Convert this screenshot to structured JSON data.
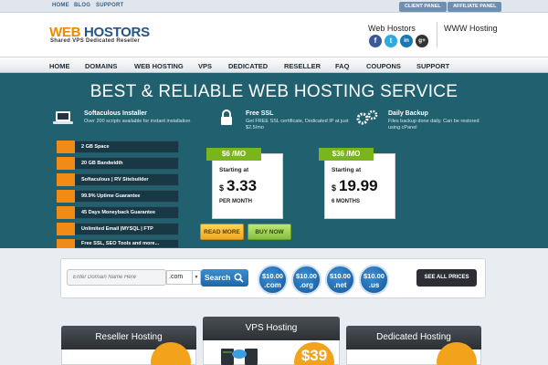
{
  "topbar": {
    "links": [
      "HOME",
      "BLOG",
      "SUPPORT"
    ],
    "client_panel": "CLIENT PANEL",
    "affiliate_panel": "AFFILIATE PANEL"
  },
  "header": {
    "logo_part1": "WEB ",
    "logo_part2": "HOSTORS",
    "tagline": "Shared   VPS   Dedicated   Reseller",
    "brand_name": "Web Hostors",
    "www_hosting": "WWW Hosting",
    "social": [
      "f",
      "t",
      "in",
      "g+"
    ]
  },
  "nav": [
    "HOME",
    "DOMAINS",
    "WEB HOSTING",
    "VPS",
    "DEDICATED",
    "RESELLER",
    "FAQ",
    "COUPONS",
    "SUPPORT"
  ],
  "banner": {
    "title": "BEST & RELIABLE WEB HOSTING SERVICE",
    "features": [
      {
        "title": "Softaculous Installer",
        "desc": "Over 200 scripts available for instant installation"
      },
      {
        "title": "Free SSL",
        "desc": "Get FREE SSL certificate, Dedicated IP at just $2.5/mo"
      },
      {
        "title": "Daily Backup",
        "desc": "Files backup done daily. Can be restored using cPanel"
      }
    ],
    "checklist": [
      "2 GB Space",
      "20 GB Bandwidth",
      "Softaculous | RV Sitebuilder",
      "99.9% Uptime Guarantee",
      "45 Days Moneyback Guarantee",
      "Unlimited Email |MYSQL | FTP",
      "Free SSL, SEO Tools and more..."
    ],
    "plans": [
      {
        "ribbon": "$6 /MO",
        "starting": "Starting at",
        "dollar": "$",
        "amount": "3.33",
        "period": "PER MONTH"
      },
      {
        "ribbon": "$36 /MO",
        "starting": "Starting at",
        "dollar": "$",
        "amount": "19.99",
        "period": "6 MONTHS"
      }
    ],
    "read_more": "READ MORE",
    "buy_now": "BUY NOW"
  },
  "domain_search": {
    "placeholder": "Enter Domain Name Here",
    "tld_selected": ".com",
    "search_label": "Search",
    "tlds": [
      {
        "price": "$10.00",
        "ext": ".com"
      },
      {
        "price": "$10.00",
        "ext": ".org"
      },
      {
        "price": "$10.00",
        "ext": ".net"
      },
      {
        "price": "$10.00",
        "ext": ".us"
      }
    ],
    "see_all": "SEE ALL PRICES"
  },
  "plans_row": {
    "reseller": "Reseller Hosting",
    "vps": "VPS Hosting",
    "vps_price": "$39",
    "dedicated": "Dedicated Hosting"
  },
  "colors": {
    "banner_bg": "#21606f",
    "orange_accent": "#f28a16",
    "ribbon_green": "#7bb51d",
    "search_blue": "#1e66a8"
  }
}
